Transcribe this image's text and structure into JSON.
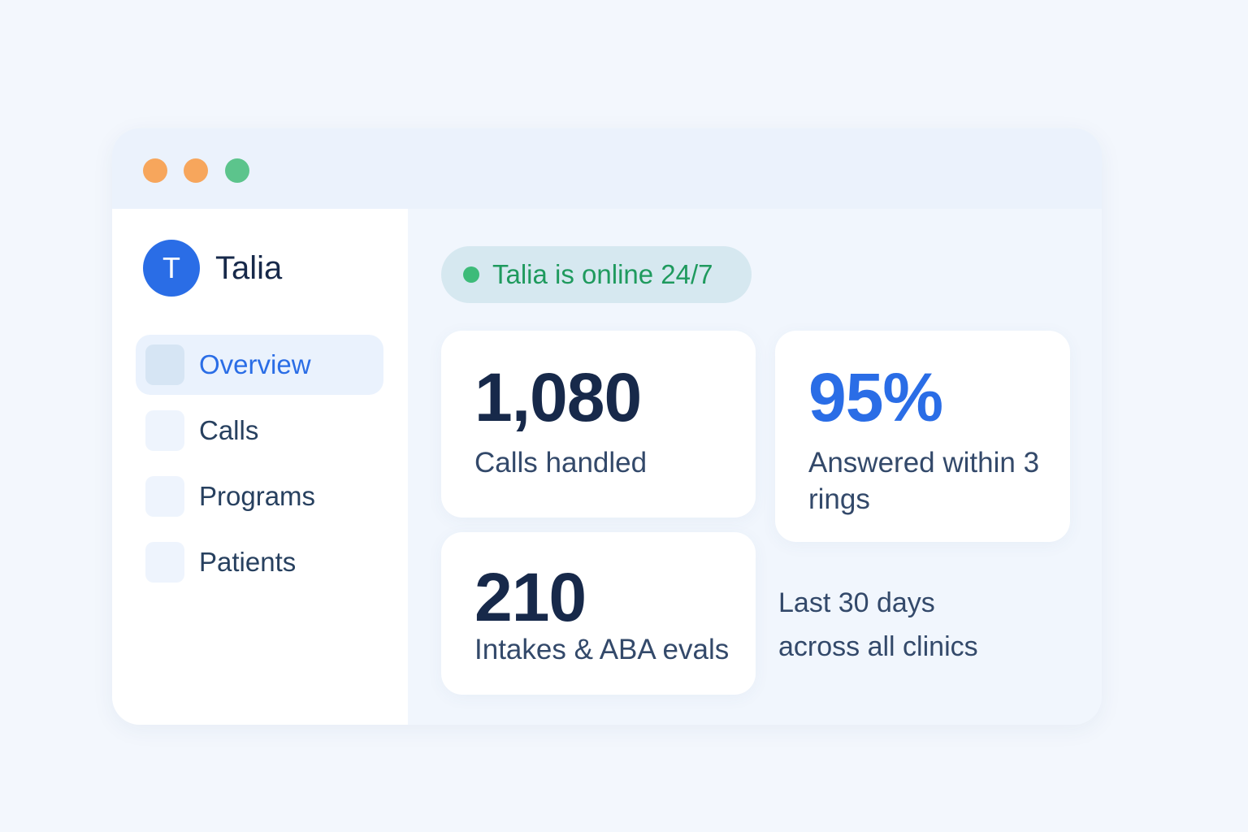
{
  "window": {
    "controls": [
      {
        "name": "close",
        "color": "#f7a65c"
      },
      {
        "name": "minimize",
        "color": "#f7a65c"
      },
      {
        "name": "maximize",
        "color": "#5cc48c"
      }
    ]
  },
  "sidebar": {
    "brand": {
      "initial": "T",
      "name": "Talia",
      "avatar_color": "#2a6de6"
    },
    "items": [
      {
        "label": "Overview",
        "active": true
      },
      {
        "label": "Calls",
        "active": false
      },
      {
        "label": "Programs",
        "active": false
      },
      {
        "label": "Patients",
        "active": false
      }
    ]
  },
  "main": {
    "status": {
      "text": "Talia is online 24/7",
      "dot_color": "#3dbb79"
    },
    "metrics": [
      {
        "value": "1,080",
        "label": "Calls handled"
      },
      {
        "value": "95%",
        "label": "Answered within 3 rings"
      },
      {
        "value": "210",
        "label": "Intakes & ABA evals"
      }
    ],
    "footnote": {
      "line1": "Last 30 days",
      "line2": "across all clinics"
    }
  },
  "colors": {
    "accent": "#2a6de6",
    "text_dark": "#17294a",
    "online_green": "#1f9a5e"
  }
}
